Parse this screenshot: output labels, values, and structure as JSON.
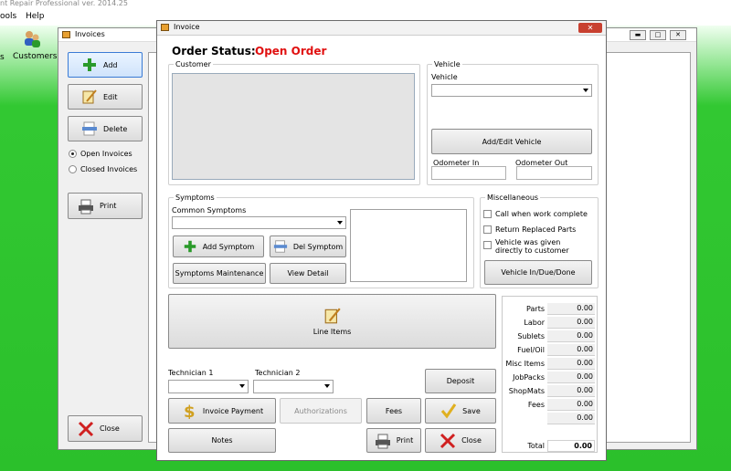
{
  "app": {
    "title": "nt Repair Professional  ver. 2014.25"
  },
  "menu": {
    "tools": "ools",
    "help": "Help"
  },
  "toolbar": {
    "customers": "Customers",
    "s_label": "s"
  },
  "invoices_window": {
    "title": "Invoices",
    "add": "Add",
    "edit": "Edit",
    "delete": "Delete",
    "open_invoices": "Open Invoices",
    "closed_invoices": "Closed Invoices",
    "print": "Print",
    "close": "Close"
  },
  "invoice_dialog": {
    "title": "Invoice",
    "order_status_label": "Order Status:",
    "order_status_value": "Open Order",
    "customer_group": "Customer",
    "vehicle_group": "Vehicle",
    "vehicle_label": "Vehicle",
    "vehicle_value": "",
    "add_edit_vehicle": "Add/Edit Vehicle",
    "odometer_in": "Odometer In",
    "odometer_out": "Odometer Out",
    "symptoms_group": "Symptoms",
    "common_symptoms": "Common Symptoms",
    "add_symptom": "Add Symptom",
    "del_symptom": "Del Symptom",
    "symptoms_maintenance": "Symptoms Maintenance",
    "view_detail": "View Detail",
    "misc_group": "Miscellaneous",
    "call_when_complete": "Call when work complete",
    "return_replaced_parts": "Return Replaced Parts",
    "vehicle_given_1": "Vehicle was given",
    "vehicle_given_2": "directly to customer",
    "vehicle_in_due_done": "Vehicle In/Due/Done",
    "line_items": "Line Items",
    "technician_1": "Technician 1",
    "technician_2": "Technician 2",
    "deposit": "Deposit",
    "invoice_payment": "Invoice Payment",
    "authorizations": "Authorizations",
    "fees": "Fees",
    "save": "Save",
    "notes": "Notes",
    "print": "Print",
    "close": "Close",
    "totals": [
      {
        "label": "Parts",
        "value": "0.00"
      },
      {
        "label": "Labor",
        "value": "0.00"
      },
      {
        "label": "Sublets",
        "value": "0.00"
      },
      {
        "label": "Fuel/Oil",
        "value": "0.00"
      },
      {
        "label": "Misc Items",
        "value": "0.00"
      },
      {
        "label": "JobPacks",
        "value": "0.00"
      },
      {
        "label": "ShopMats",
        "value": "0.00"
      },
      {
        "label": "Fees",
        "value": "0.00"
      },
      {
        "label": "",
        "value": "0.00"
      }
    ],
    "total_label": "Total",
    "total_value": "0.00"
  },
  "colors": {
    "status_red": "#e01010",
    "ribbon_green": "#2bc02b"
  }
}
